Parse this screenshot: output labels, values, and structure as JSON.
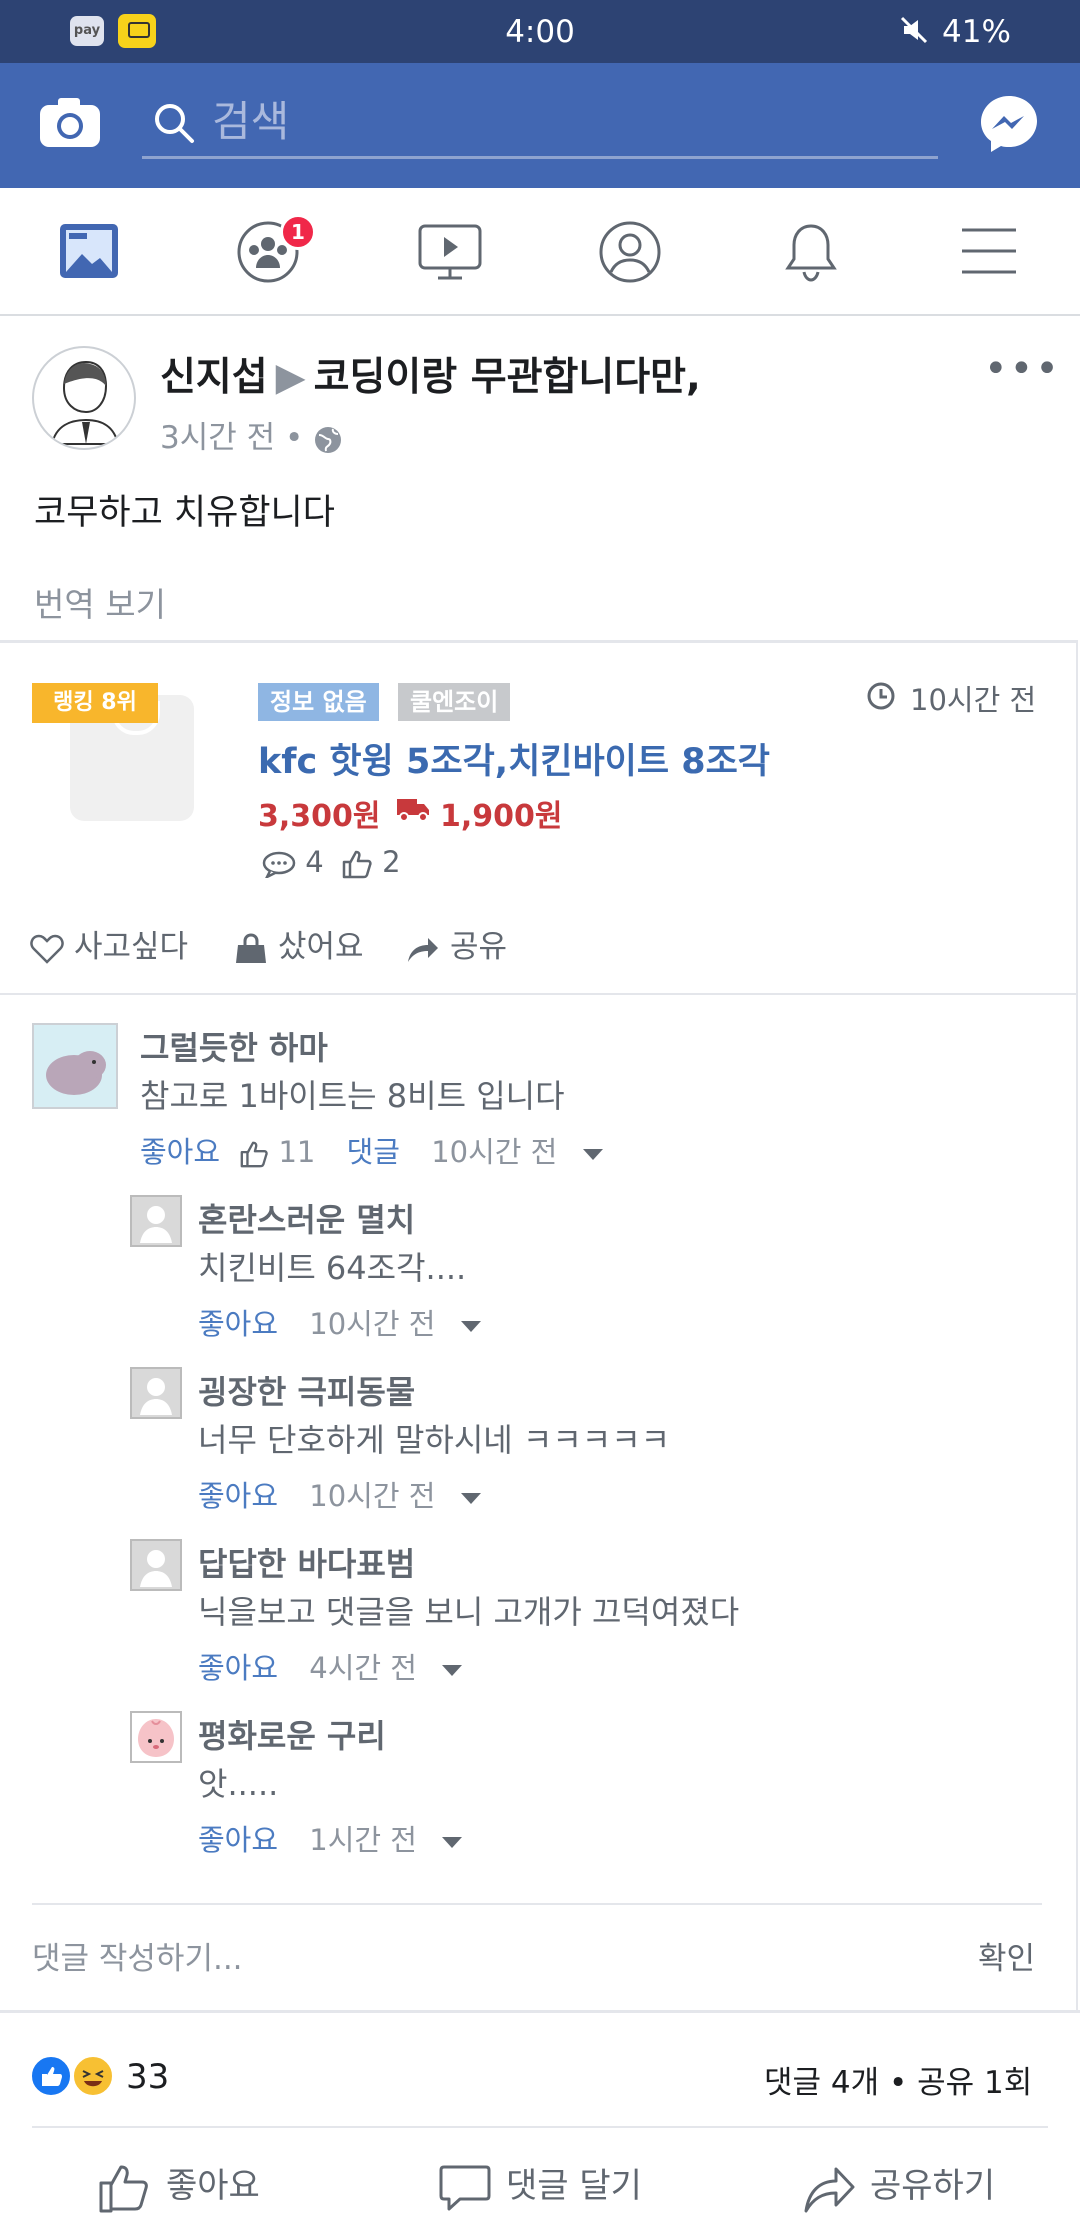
{
  "status": {
    "time": "4:00",
    "battery": "41%",
    "pay_label": "pay"
  },
  "search": {
    "placeholder": "검색"
  },
  "nav": {
    "badge": "1"
  },
  "post": {
    "author": "신지섭",
    "group": "코딩이랑 무관합니다만,",
    "time": "3시간 전 •",
    "text": "코무하고 치유합니다",
    "translate": "번역 보기"
  },
  "product": {
    "rank": "랭킹 8위",
    "tags": [
      "정보 없음",
      "쿨엔조이"
    ],
    "time": "10시간 전",
    "title": "kfc 핫윙 5조각,치킨바이트 8조각",
    "price": "3,300원",
    "shipping": "1,900원",
    "comments": "4",
    "likes": "2",
    "actions": [
      "사고싶다",
      "샀어요",
      "공유"
    ]
  },
  "comments": [
    {
      "name": "그럴듯한 하마",
      "text": "참고로 1바이트는 8비트 입니다",
      "like": "좋아요",
      "like_count": "11",
      "reply": "댓글",
      "time": "10시간 전"
    },
    {
      "name": "혼란스러운 멸치",
      "text": "치킨비트 64조각....",
      "like": "좋아요",
      "time": "10시간 전"
    },
    {
      "name": "굉장한 극피동물",
      "text": "너무 단호하게 말하시네 ㅋㅋㅋㅋㅋ",
      "like": "좋아요",
      "time": "10시간 전"
    },
    {
      "name": "답답한 바다표범",
      "text": "닉을보고 댓글을 보니 고개가 끄덕여졌다",
      "like": "좋아요",
      "time": "4시간 전"
    },
    {
      "name": "평화로운 구리",
      "text": "앗.....",
      "like": "좋아요",
      "time": "1시간 전"
    }
  ],
  "write": {
    "placeholder": "댓글 작성하기...",
    "confirm": "확인"
  },
  "reactions": {
    "count": "33",
    "summary": "댓글 4개 • 공유 1회"
  },
  "bottom_actions": [
    "좋아요",
    "댓글 달기",
    "공유하기"
  ],
  "colors": {
    "brand": "#4267b2",
    "status_bar": "#2d4373",
    "product_title": "#3b6ab0",
    "price": "#c8393c",
    "rank": "#f8b62c"
  }
}
